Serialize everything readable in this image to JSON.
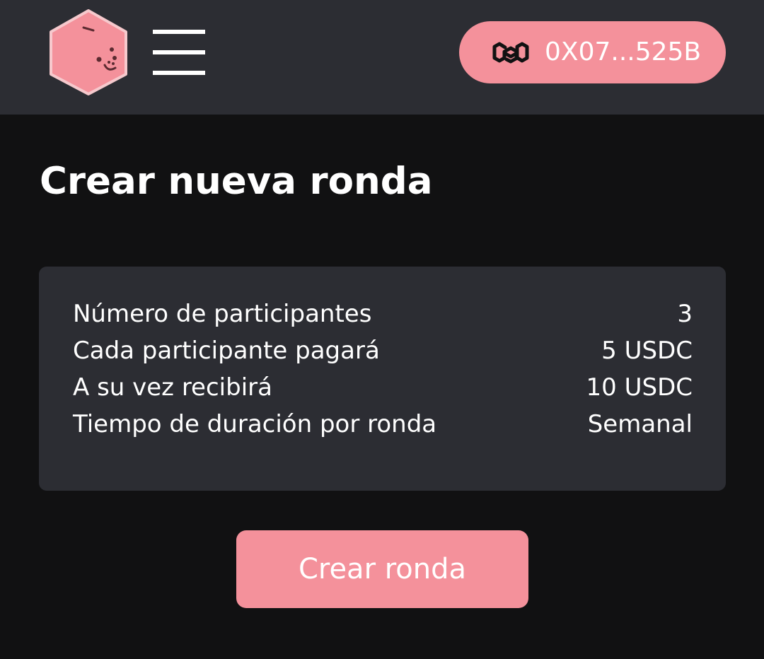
{
  "header": {
    "logo_icon": "hexagon-piggy-logo-icon",
    "menu_icon": "hamburger-menu-icon",
    "wallet": {
      "network_icon": "polygon-icon",
      "address": "0X07...525B"
    }
  },
  "main": {
    "title": "Crear nueva ronda",
    "summary": {
      "rows": [
        {
          "label": "Número de participantes",
          "value": "3"
        },
        {
          "label": "Cada participante pagará",
          "value": "5 USDC"
        },
        {
          "label": "A su vez recibirá",
          "value": "10 USDC"
        },
        {
          "label": "Tiempo de duración por ronda",
          "value": "Semanal"
        }
      ]
    },
    "create_button_label": "Crear ronda"
  },
  "colors": {
    "header_bg": "#2c2d33",
    "page_bg": "#111112",
    "card_bg": "#2c2d33",
    "accent": "#f4919b",
    "text": "#ffffff"
  }
}
